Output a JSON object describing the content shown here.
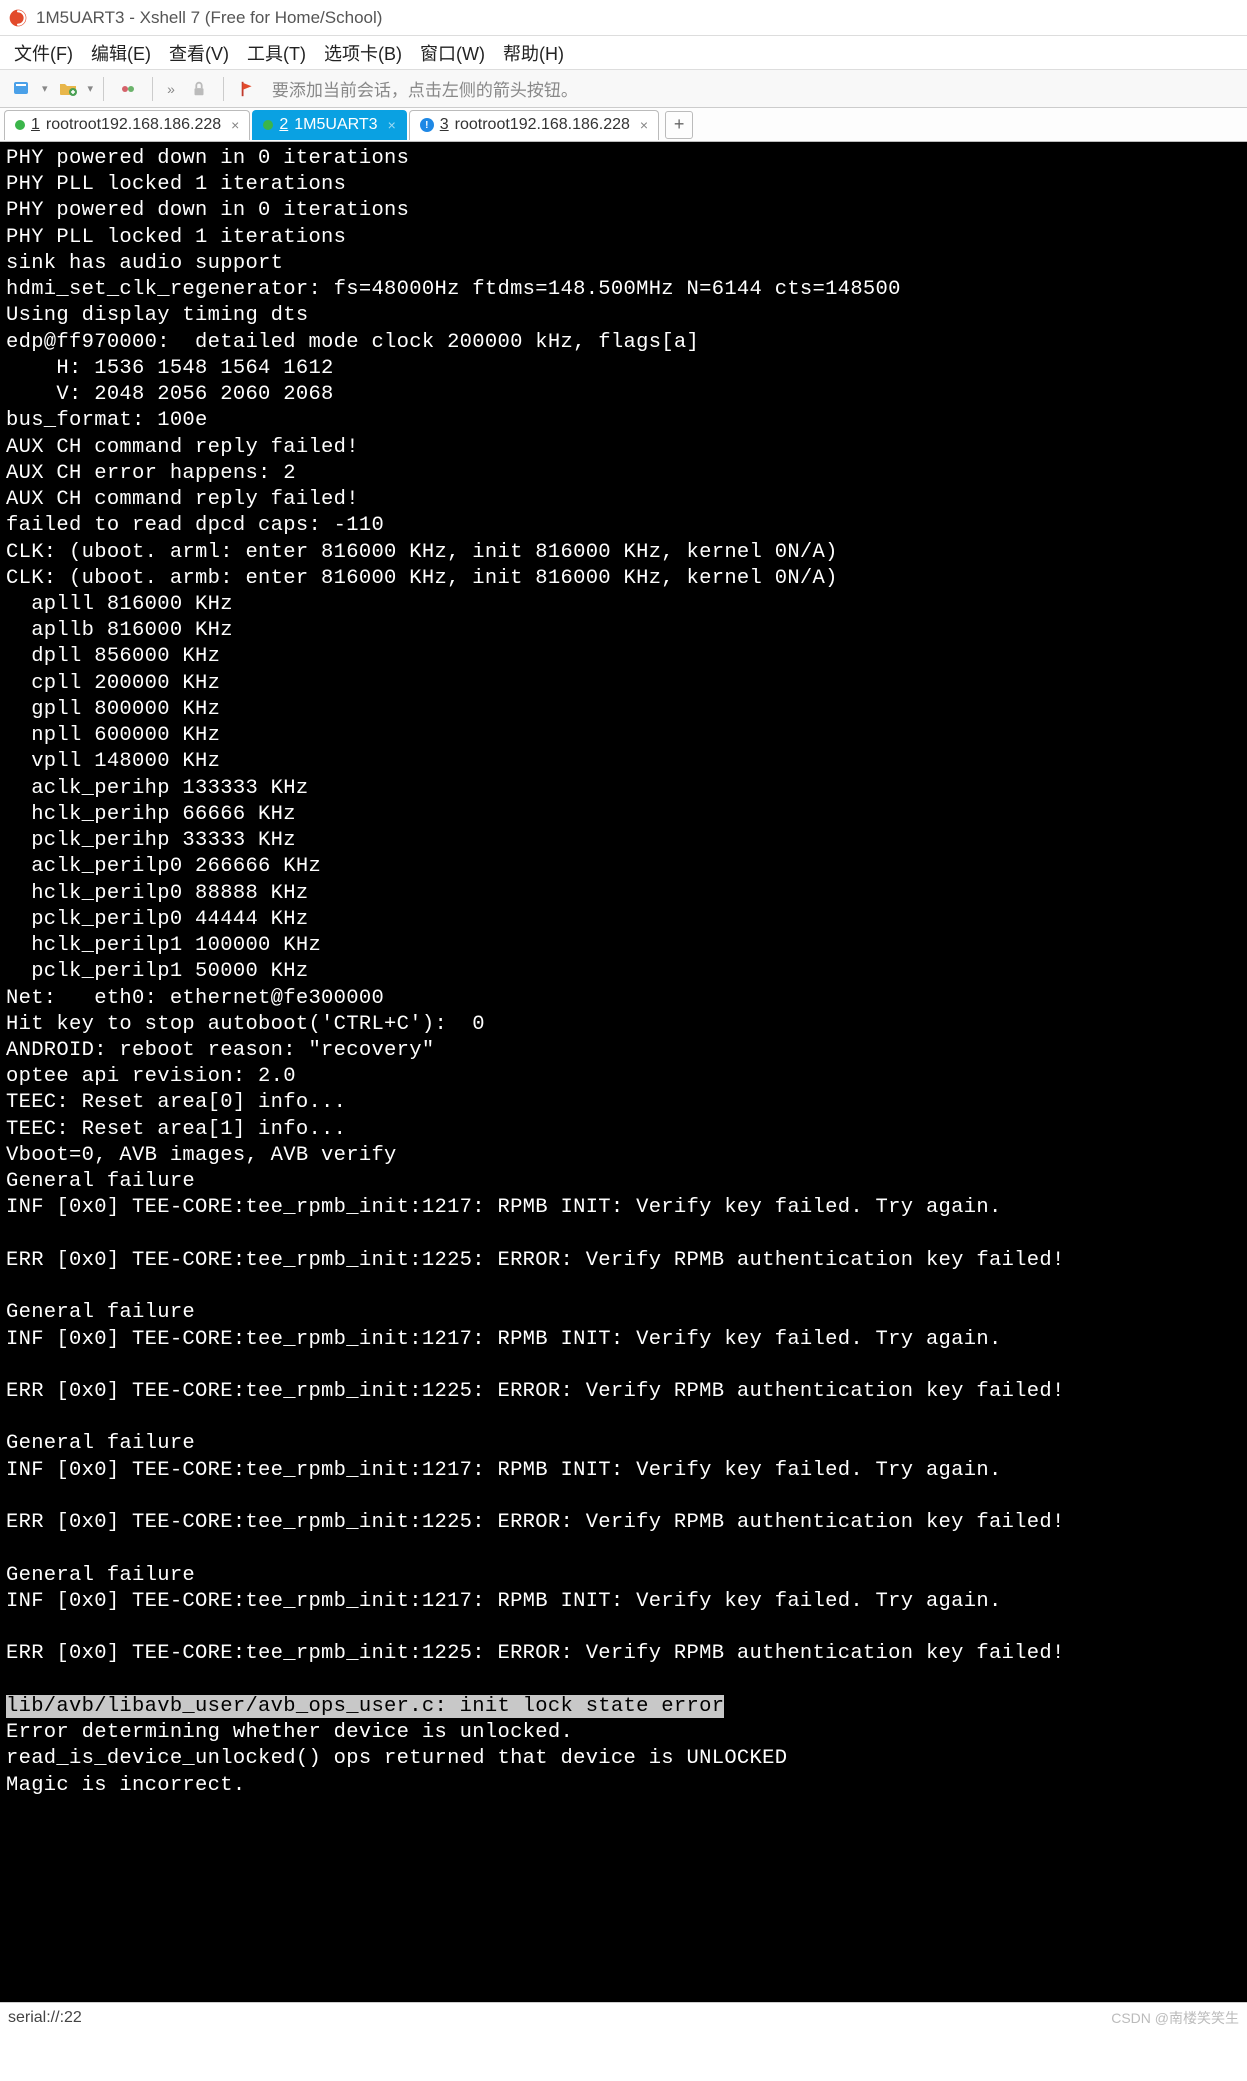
{
  "title": "1M5UART3 - Xshell 7 (Free for Home/School)",
  "menu": [
    "文件(F)",
    "编辑(E)",
    "查看(V)",
    "工具(T)",
    "选项卡(B)",
    "窗口(W)",
    "帮助(H)"
  ],
  "toolbar_hint": "要添加当前会话，点击左侧的箭头按钮。",
  "tabs": [
    {
      "num": "1",
      "label": "rootroot192.168.186.228",
      "status": "ok",
      "active": false
    },
    {
      "num": "2",
      "label": "1M5UART3",
      "status": "ok",
      "active": true
    },
    {
      "num": "3",
      "label": "rootroot192.168.186.228",
      "status": "info",
      "active": false
    }
  ],
  "terminal_lines": [
    "PHY powered down in 0 iterations",
    "PHY PLL locked 1 iterations",
    "PHY powered down in 0 iterations",
    "PHY PLL locked 1 iterations",
    "sink has audio support",
    "hdmi_set_clk_regenerator: fs=48000Hz ftdms=148.500MHz N=6144 cts=148500",
    "Using display timing dts",
    "edp@ff970000:  detailed mode clock 200000 kHz, flags[a]",
    "    H: 1536 1548 1564 1612",
    "    V: 2048 2056 2060 2068",
    "bus_format: 100e",
    "AUX CH command reply failed!",
    "AUX CH error happens: 2",
    "AUX CH command reply failed!",
    "failed to read dpcd caps: -110",
    "CLK: (uboot. arml: enter 816000 KHz, init 816000 KHz, kernel 0N/A)",
    "CLK: (uboot. armb: enter 816000 KHz, init 816000 KHz, kernel 0N/A)",
    "  aplll 816000 KHz",
    "  apllb 816000 KHz",
    "  dpll 856000 KHz",
    "  cpll 200000 KHz",
    "  gpll 800000 KHz",
    "  npll 600000 KHz",
    "  vpll 148000 KHz",
    "  aclk_perihp 133333 KHz",
    "  hclk_perihp 66666 KHz",
    "  pclk_perihp 33333 KHz",
    "  aclk_perilp0 266666 KHz",
    "  hclk_perilp0 88888 KHz",
    "  pclk_perilp0 44444 KHz",
    "  hclk_perilp1 100000 KHz",
    "  pclk_perilp1 50000 KHz",
    "Net:   eth0: ethernet@fe300000",
    "Hit key to stop autoboot('CTRL+C'):  0",
    "ANDROID: reboot reason: \"recovery\"",
    "optee api revision: 2.0",
    "TEEC: Reset area[0] info...",
    "TEEC: Reset area[1] info...",
    "Vboot=0, AVB images, AVB verify",
    "General failure",
    "INF [0x0] TEE-CORE:tee_rpmb_init:1217: RPMB INIT: Verify key failed. Try again.",
    "",
    "ERR [0x0] TEE-CORE:tee_rpmb_init:1225: ERROR: Verify RPMB authentication key failed!",
    "",
    "General failure",
    "INF [0x0] TEE-CORE:tee_rpmb_init:1217: RPMB INIT: Verify key failed. Try again.",
    "",
    "ERR [0x0] TEE-CORE:tee_rpmb_init:1225: ERROR: Verify RPMB authentication key failed!",
    "",
    "General failure",
    "INF [0x0] TEE-CORE:tee_rpmb_init:1217: RPMB INIT: Verify key failed. Try again.",
    "",
    "ERR [0x0] TEE-CORE:tee_rpmb_init:1225: ERROR: Verify RPMB authentication key failed!",
    "",
    "General failure",
    "INF [0x0] TEE-CORE:tee_rpmb_init:1217: RPMB INIT: Verify key failed. Try again.",
    "",
    "ERR [0x0] TEE-CORE:tee_rpmb_init:1225: ERROR: Verify RPMB authentication key failed!",
    ""
  ],
  "highlight_line": "lib/avb/libavb_user/avb_ops_user.c: init lock state error",
  "after_highlight": [
    "Error determining whether device is unlocked.",
    "read_is_device_unlocked() ops returned that device is UNLOCKED",
    "Magic is incorrect.",
    ""
  ],
  "status_left": "serial://:22",
  "watermark": "CSDN @南楼笑笑生"
}
